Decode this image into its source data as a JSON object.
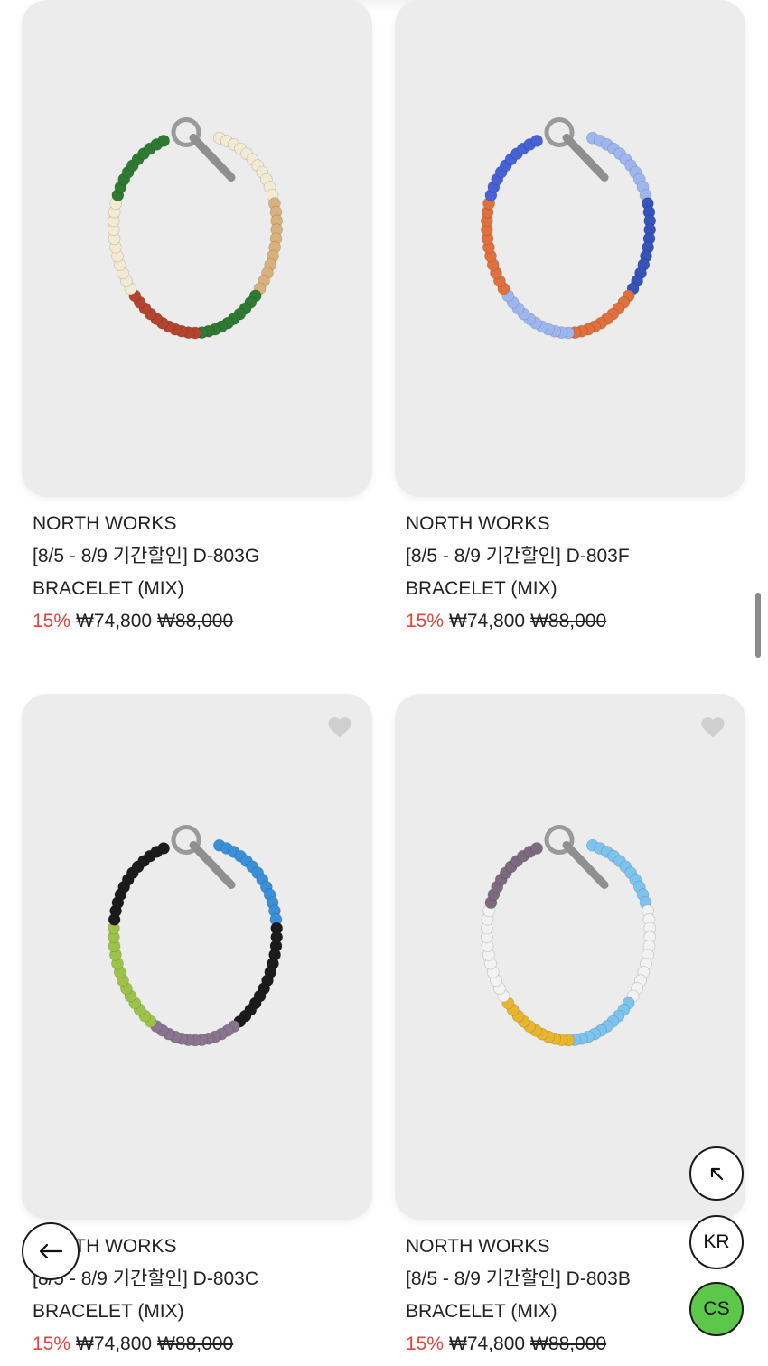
{
  "products": [
    {
      "brand": "NORTH WORKS",
      "title": "[8/5 - 8/9 기간할인] D-803G",
      "subtitle": "BRACELET (MIX)",
      "discount": "15%",
      "sale_price": "₩74,800",
      "original_price": "₩88,000",
      "bead_colors": [
        "#f3ead3",
        "#d9b17a",
        "#2f7a32",
        "#b3452e",
        "#f3ead3",
        "#2f7a32"
      ]
    },
    {
      "brand": "NORTH WORKS",
      "title": "[8/5 - 8/9 기간할인] D-803F",
      "subtitle": "BRACELET (MIX)",
      "discount": "15%",
      "sale_price": "₩74,800",
      "original_price": "₩88,000",
      "bead_colors": [
        "#9db7ee",
        "#3553b8",
        "#e0703d",
        "#9db7ee",
        "#e0703d",
        "#4761d6"
      ]
    },
    {
      "brand": "NORTH WORKS",
      "title": "[8/5 - 8/9 기간할인] D-803C",
      "subtitle": "BRACELET (MIX)",
      "discount": "15%",
      "sale_price": "₩74,800",
      "original_price": "₩88,000",
      "bead_colors": [
        "#3a8fd9",
        "#1b1b1b",
        "#8a7590",
        "#9cc24a",
        "#1b1b1b"
      ]
    },
    {
      "brand": "NORTH WORKS",
      "title": "[8/5 - 8/9 기간할인] D-803B",
      "subtitle": "BRACELET (MIX)",
      "discount": "15%",
      "sale_price": "₩74,800",
      "original_price": "₩88,000",
      "bead_colors": [
        "#7cc4ee",
        "#f2f2f2",
        "#7cc4ee",
        "#e8b52e",
        "#f2f2f2",
        "#7d6a7f"
      ]
    }
  ],
  "floating": {
    "scroll_top_icon": "arrow-up-left-icon",
    "language_label": "KR",
    "cs_label": "CS",
    "back_icon": "arrow-left-icon"
  },
  "colors": {
    "discount": "#e0443a",
    "cs_button": "#5cc748",
    "card_background": "#ececec"
  }
}
